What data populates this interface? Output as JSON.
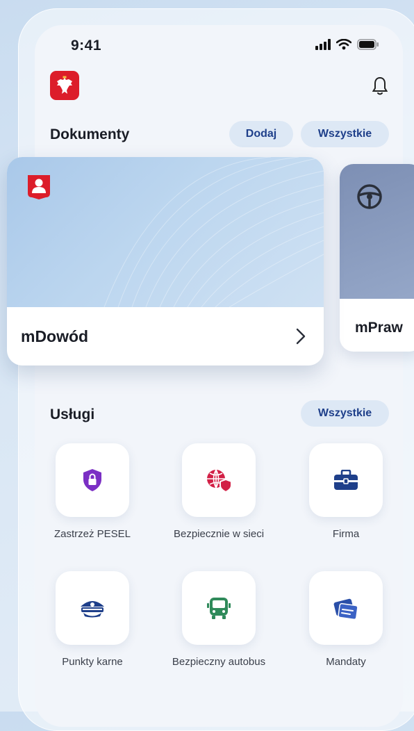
{
  "status_bar": {
    "time": "9:41"
  },
  "header": {
    "logo_icon": "polish-eagle-emblem",
    "notification_icon": "bell-icon"
  },
  "documents": {
    "title": "Dokumenty",
    "add_label": "Dodaj",
    "all_label": "Wszystkie",
    "cards": [
      {
        "name": "mDowód",
        "icon": "person-badge-icon"
      },
      {
        "name": "mPraw",
        "icon": "steering-wheel-icon"
      }
    ]
  },
  "services": {
    "title": "Usługi",
    "all_label": "Wszystkie",
    "items": [
      {
        "label": "Zastrzeż PESEL",
        "icon": "shield-lock-icon",
        "color": "#7b2fc4"
      },
      {
        "label": "Bezpiecznie w sieci",
        "icon": "globe-shield-icon",
        "color": "#d21f45"
      },
      {
        "label": "Firma",
        "icon": "briefcase-icon",
        "color": "#1e3f8a"
      },
      {
        "label": "Punkty karne",
        "icon": "police-cap-icon",
        "color": "#1e3f8a"
      },
      {
        "label": "Bezpieczny autobus",
        "icon": "bus-icon",
        "color": "#2f8a5a"
      },
      {
        "label": "Mandaty",
        "icon": "tickets-icon",
        "color": "#2a4fa8"
      }
    ]
  },
  "colors": {
    "accent": "#1e3f8a",
    "brand_red": "#dc1d2a",
    "pill_bg": "#dde8f5"
  }
}
